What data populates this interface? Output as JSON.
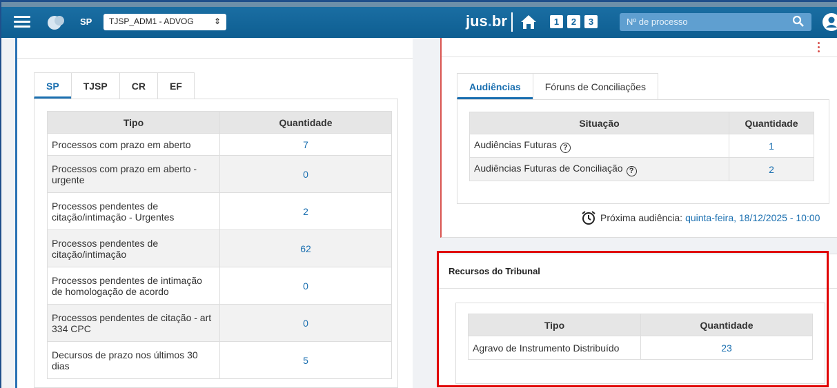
{
  "header": {
    "state": "SP",
    "profile": "TJSP_ADM1 - ADVOG",
    "brand_main": "jus",
    "brand_dot": ".",
    "brand_tail": "br",
    "quick_numbers": [
      "1",
      "2",
      "3"
    ],
    "process_search_placeholder": "Nº de processo"
  },
  "left": {
    "tabs": [
      "SP",
      "TJSP",
      "CR",
      "EF"
    ],
    "columns": [
      "Tipo",
      "Quantidade"
    ],
    "rows": [
      {
        "tipo": "Processos com prazo em aberto",
        "qtd": "7"
      },
      {
        "tipo": "Processos com prazo em aberto - urgente",
        "qtd": "0"
      },
      {
        "tipo": "Processos pendentes de citação/intimação - Urgentes",
        "qtd": "2"
      },
      {
        "tipo": "Processos pendentes de citação/intimação",
        "qtd": "62"
      },
      {
        "tipo": "Processos pendentes de intimação de homologação de acordo",
        "qtd": "0"
      },
      {
        "tipo": "Processos pendentes de citação - art 334 CPC",
        "qtd": "0"
      },
      {
        "tipo": "Decursos de prazo nos últimos 30 dias",
        "qtd": "5"
      }
    ]
  },
  "hearings": {
    "tabs": [
      "Audiências",
      "Fóruns de Conciliações"
    ],
    "columns": [
      "Situação",
      "Quantidade"
    ],
    "rows": [
      {
        "situacao": "Audiências Futuras",
        "qtd": "1"
      },
      {
        "situacao": "Audiências Futuras de Conciliação",
        "qtd": "2"
      }
    ],
    "next_label": "Próxima audiência:",
    "next_value": "quinta-feira, 18/12/2025 - 10:00"
  },
  "recursos": {
    "title": "Recursos do Tribunal",
    "columns": [
      "Tipo",
      "Quantidade"
    ],
    "rows": [
      {
        "tipo": "Agravo de Instrumento Distribuído",
        "qtd": "23"
      }
    ]
  },
  "colors": {
    "navbar": "#1668a0",
    "accent": "#1a6fb0",
    "highlight": "#e00000",
    "hearing_border": "#d9534f"
  }
}
